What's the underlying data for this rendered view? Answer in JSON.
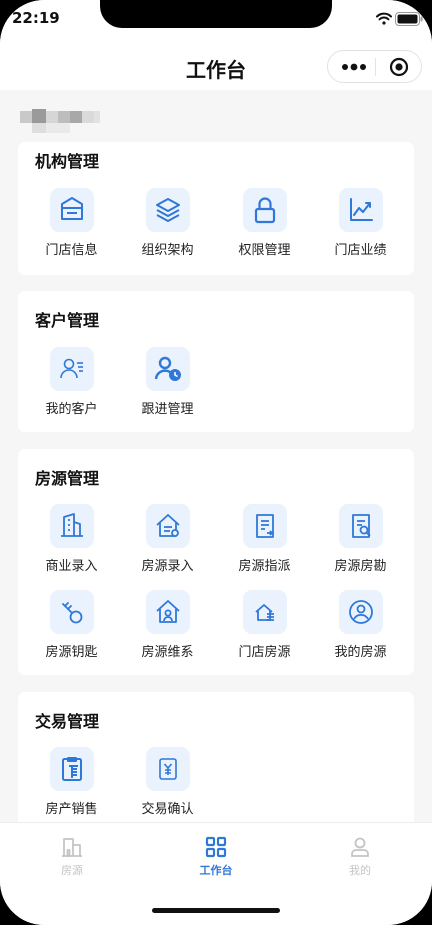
{
  "status_bar": {
    "time": "22:19"
  },
  "nav": {
    "title": "工作台"
  },
  "sections": [
    {
      "title": "机构管理",
      "items": [
        {
          "label": "门店信息",
          "icon": "store-info-icon"
        },
        {
          "label": "组织架构",
          "icon": "layers-icon"
        },
        {
          "label": "权限管理",
          "icon": "lock-icon"
        },
        {
          "label": "门店业绩",
          "icon": "trend-chart-icon"
        }
      ]
    },
    {
      "title": "客户管理",
      "items": [
        {
          "label": "我的客户",
          "icon": "customer-icon"
        },
        {
          "label": "跟进管理",
          "icon": "follow-up-icon"
        }
      ]
    },
    {
      "title": "房源管理",
      "items": [
        {
          "label": "商业录入",
          "icon": "commercial-building-icon"
        },
        {
          "label": "房源录入",
          "icon": "house-entry-icon"
        },
        {
          "label": "房源指派",
          "icon": "assign-document-icon"
        },
        {
          "label": "房源房勘",
          "icon": "survey-document-icon"
        },
        {
          "label": "房源钥匙",
          "icon": "key-icon"
        },
        {
          "label": "房源维系",
          "icon": "house-maintain-icon"
        },
        {
          "label": "门店房源",
          "icon": "store-house-icon"
        },
        {
          "label": "我的房源",
          "icon": "my-house-icon"
        }
      ]
    },
    {
      "title": "交易管理",
      "items": [
        {
          "label": "房产销售",
          "icon": "sale-clipboard-icon"
        },
        {
          "label": "交易确认",
          "icon": "yuan-confirm-icon"
        }
      ]
    }
  ],
  "tabs": [
    {
      "label": "房源",
      "icon": "building-icon",
      "active": false
    },
    {
      "label": "工作台",
      "icon": "grid-icon",
      "active": true
    },
    {
      "label": "我的",
      "icon": "user-icon",
      "active": false
    }
  ],
  "colors": {
    "accent": "#2f78d8",
    "icon_bg": "#eaf2fd",
    "inactive": "#c4c4c4"
  }
}
